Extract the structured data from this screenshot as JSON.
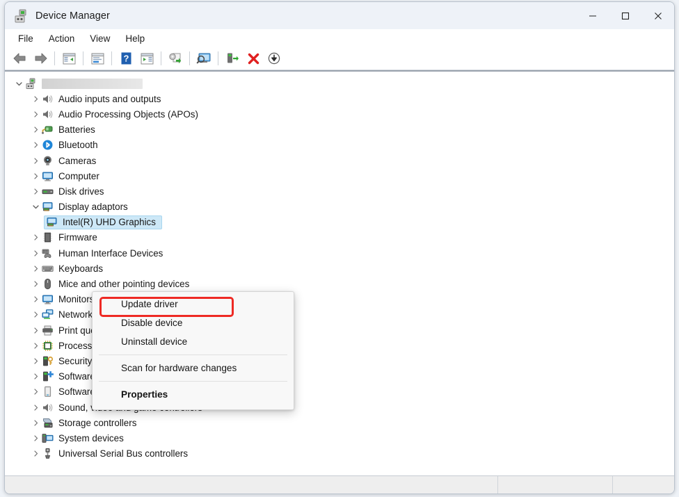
{
  "window": {
    "title": "Device Manager",
    "title_icon": "device-manager-icon",
    "controls": [
      {
        "name": "minimize-button",
        "glyph": "minimize-icon"
      },
      {
        "name": "maximize-button",
        "glyph": "maximize-icon"
      },
      {
        "name": "close-button",
        "glyph": "close-icon"
      }
    ]
  },
  "menubar": {
    "items": [
      {
        "label": "File"
      },
      {
        "label": "Action"
      },
      {
        "label": "View"
      },
      {
        "label": "Help"
      }
    ]
  },
  "toolbar": {
    "buttons": [
      {
        "name": "back-button",
        "icon": "back-arrow-icon"
      },
      {
        "name": "forward-button",
        "icon": "forward-arrow-icon"
      },
      {
        "name": "show-hide-console-tree-button",
        "icon": "console-tree-icon"
      },
      {
        "name": "properties-button",
        "icon": "properties-window-icon"
      },
      {
        "name": "help-button",
        "icon": "help-question-icon"
      },
      {
        "name": "show-hide-action-pane-button",
        "icon": "action-pane-icon"
      },
      {
        "name": "update-driver-button",
        "icon": "update-driver-icon"
      },
      {
        "name": "scan-for-hardware-changes-button",
        "icon": "scan-monitor-icon"
      },
      {
        "name": "enable-device-button",
        "icon": "enable-device-icon"
      },
      {
        "name": "uninstall-device-button",
        "icon": "red-x-icon"
      },
      {
        "name": "add-legacy-hardware-button",
        "icon": "download-arrow-icon"
      }
    ]
  },
  "tree": {
    "root": {
      "name": "computer-root-node",
      "label": "",
      "redacted": true,
      "icon": "computer-root-icon",
      "expanded": true
    },
    "items": [
      {
        "label": "Audio inputs and outputs",
        "icon": "speaker-icon",
        "expanded": false,
        "depth": 1
      },
      {
        "label": "Audio Processing Objects (APOs)",
        "icon": "speaker-icon",
        "expanded": false,
        "depth": 1
      },
      {
        "label": "Batteries",
        "icon": "battery-icon",
        "expanded": false,
        "depth": 1
      },
      {
        "label": "Bluetooth",
        "icon": "bluetooth-icon",
        "expanded": false,
        "depth": 1
      },
      {
        "label": "Cameras",
        "icon": "camera-icon",
        "expanded": false,
        "depth": 1
      },
      {
        "label": "Computer",
        "icon": "monitor-icon",
        "expanded": false,
        "depth": 1
      },
      {
        "label": "Disk drives",
        "icon": "disk-drive-icon",
        "expanded": false,
        "depth": 1
      },
      {
        "label": "Display adaptors",
        "icon": "display-adapter-icon",
        "expanded": true,
        "depth": 1
      },
      {
        "label": "Intel(R) UHD Graphics",
        "icon": "display-adapter-icon",
        "selected": true,
        "depth": 2
      },
      {
        "label": "Firmware",
        "icon": "firmware-icon",
        "expanded": false,
        "depth": 1
      },
      {
        "label": "Human Interface Devices",
        "icon": "hid-icon",
        "expanded": false,
        "depth": 1
      },
      {
        "label": "Keyboards",
        "icon": "keyboard-icon",
        "expanded": false,
        "depth": 1
      },
      {
        "label": "Mice and other pointing devices",
        "icon": "mouse-icon",
        "expanded": false,
        "depth": 1
      },
      {
        "label": "Monitors",
        "icon": "monitor-icon",
        "expanded": false,
        "depth": 1
      },
      {
        "label": "Network adapters",
        "icon": "network-adapter-icon",
        "expanded": false,
        "depth": 1
      },
      {
        "label": "Print queues",
        "icon": "printer-icon",
        "expanded": false,
        "depth": 1
      },
      {
        "label": "Processors",
        "icon": "processor-icon",
        "expanded": false,
        "depth": 1
      },
      {
        "label": "Security devices",
        "icon": "security-device-icon",
        "expanded": false,
        "depth": 1
      },
      {
        "label": "Software components",
        "icon": "software-component-icon",
        "expanded": false,
        "depth": 1
      },
      {
        "label": "Software devices",
        "icon": "software-device-icon",
        "expanded": false,
        "depth": 1
      },
      {
        "label": "Sound, video and game controllers",
        "icon": "speaker-icon",
        "expanded": false,
        "depth": 1
      },
      {
        "label": "Storage controllers",
        "icon": "storage-controller-icon",
        "expanded": false,
        "depth": 1
      },
      {
        "label": "System devices",
        "icon": "system-device-icon",
        "expanded": false,
        "depth": 1
      },
      {
        "label": "Universal Serial Bus controllers",
        "icon": "usb-icon",
        "expanded": false,
        "depth": 1
      }
    ]
  },
  "context_menu": {
    "items": [
      {
        "label": "Update driver",
        "bold": false,
        "highlighted": true
      },
      {
        "label": "Disable device",
        "bold": false
      },
      {
        "label": "Uninstall device",
        "bold": false
      },
      {
        "separator": true
      },
      {
        "label": "Scan for hardware changes",
        "bold": false
      },
      {
        "separator": true
      },
      {
        "label": "Properties",
        "bold": true
      }
    ]
  },
  "colors": {
    "highlight_red": "#ee2a24",
    "selection_blue": "#cde8f7",
    "titlebar": "#eef2f8",
    "menu_bg": "#f8f8f8"
  }
}
